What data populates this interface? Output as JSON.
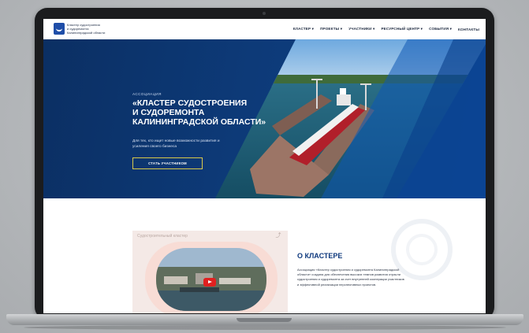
{
  "header": {
    "logo_lines": [
      "Кластер судостроения",
      "и судоремонта",
      "Калининградской области"
    ],
    "nav": [
      "КЛАСТЕР ▾",
      "ПРОЕКТЫ ▾",
      "УЧАСТНИКИ ▾",
      "РЕСУРСНЫЙ ЦЕНТР ▾",
      "СОБЫТИЯ ▾",
      "КОНТАКТЫ"
    ]
  },
  "hero": {
    "eyebrow": "АССОЦИАЦИЯ",
    "title_lines": [
      "«КЛАСТЕР СУДОСТРОЕНИЯ",
      "И СУДОРЕМОНТА",
      "КАЛИНИНГРАДСКОЙ ОБЛАСТИ»"
    ],
    "subtitle": "Для тех, кто ищет новые возможности развития и усиления своего бизнеса",
    "cta_label": "СТАТЬ УЧАСТНИКОМ"
  },
  "about": {
    "video_title": "Судостроительный кластер",
    "title": "О КЛАСТЕРЕ",
    "body": "Ассоциация «Кластер судостроения и судоремонта Калининградской области» создана для обеспечения высоких темпов развития отрасли судостроения и судоремонта за счет внутренней кооперации участников и эффективной реализации перспективных проектов."
  },
  "colors": {
    "brand_blue": "#0d3a78",
    "cta_border": "#d8c94a",
    "play_red": "#e02020"
  },
  "icons": {
    "share": "share-icon",
    "play": "play-icon",
    "logo": "anchor-logo-icon"
  }
}
